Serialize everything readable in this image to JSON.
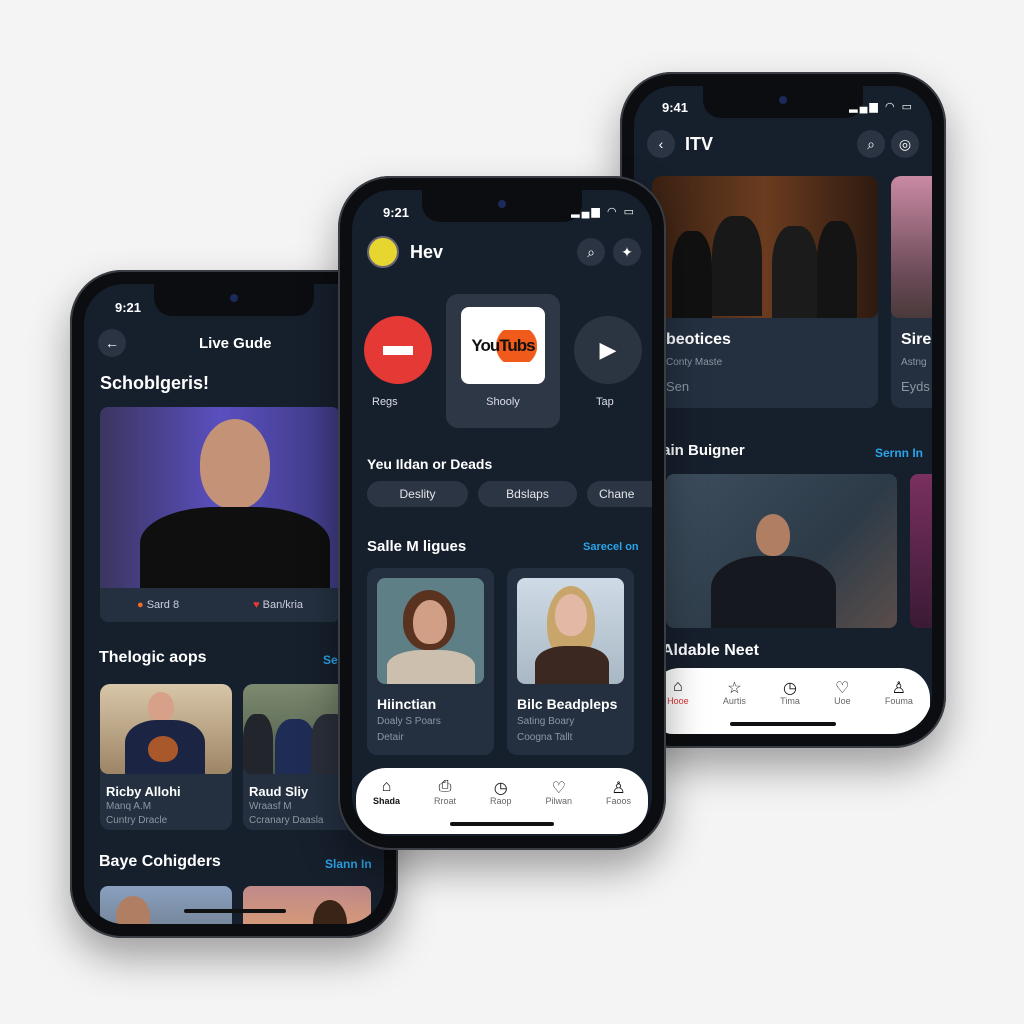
{
  "left_phone": {
    "status_time": "9:21",
    "title": "Live Gude",
    "heading": "Schoblgeris!",
    "hero_meta": [
      {
        "icon": "channel-logo-icon",
        "label": "Sard 8"
      },
      {
        "icon": "heart-icon",
        "label": "Ban/kria"
      }
    ],
    "section1": {
      "title": "Thelogic aops",
      "link": "Se"
    },
    "cards": [
      {
        "title": "Ricby Allohi",
        "line1": "Manq A.M",
        "line2": "Cuntry Dracle"
      },
      {
        "title": "Raud Sliy",
        "line1": "Wraasf M",
        "line2": "Ccranary Daasla"
      }
    ],
    "section2": {
      "title": "Baye Cohigders",
      "link": "Slann In"
    }
  },
  "middle_phone": {
    "status_time": "9:21",
    "title": "Hev",
    "apps": [
      {
        "label": "Regs",
        "color": "#e53935"
      },
      {
        "label": "Shooly",
        "logo": "YouTubs"
      },
      {
        "label": "Tap"
      }
    ],
    "section1": {
      "title": "Yeu Ildan or Deads"
    },
    "chips": [
      "Deslity",
      "Bdslaps",
      "Chane"
    ],
    "section2": {
      "title": "Salle M ligues",
      "link": "Sarecel on"
    },
    "cards": [
      {
        "title": "Hiinctian",
        "line1": "Doaly S Poars",
        "line2": "Detair"
      },
      {
        "title": "Bilc Beadpleps",
        "line1": "Sating Boary",
        "line2": "Coogna Tallt"
      }
    ],
    "nav": [
      {
        "icon": "home-icon",
        "label": "Shada",
        "active": true
      },
      {
        "icon": "cast-icon",
        "label": "Rroat"
      },
      {
        "icon": "clock-icon",
        "label": "Raop"
      },
      {
        "icon": "heart-icon",
        "label": "Pilwan"
      },
      {
        "icon": "profile-icon",
        "label": "Faoos"
      }
    ]
  },
  "right_phone": {
    "status_time": "9:41",
    "title": "ITV",
    "cards": [
      {
        "title": "beotices",
        "line1": "Conty Maste",
        "line2": "Sen"
      },
      {
        "title": "Sire",
        "line1": "Astng",
        "line2": "Eyds"
      }
    ],
    "section": {
      "title": "Train Buigner",
      "link": "Sernn In"
    },
    "feature_title": "Aldable Neet",
    "nav": [
      {
        "icon": "home-icon",
        "label": "Hooe",
        "active": true
      },
      {
        "icon": "star-icon",
        "label": "Aurtis"
      },
      {
        "icon": "clock-icon",
        "label": "Tima"
      },
      {
        "icon": "heart-icon",
        "label": "Uoe"
      },
      {
        "icon": "profile-icon",
        "label": "Fouma"
      }
    ]
  },
  "colors": {
    "screen_bg": "#161f2c",
    "card_bg": "#243040",
    "accent": "#2aa4e8",
    "red": "#e53935"
  }
}
